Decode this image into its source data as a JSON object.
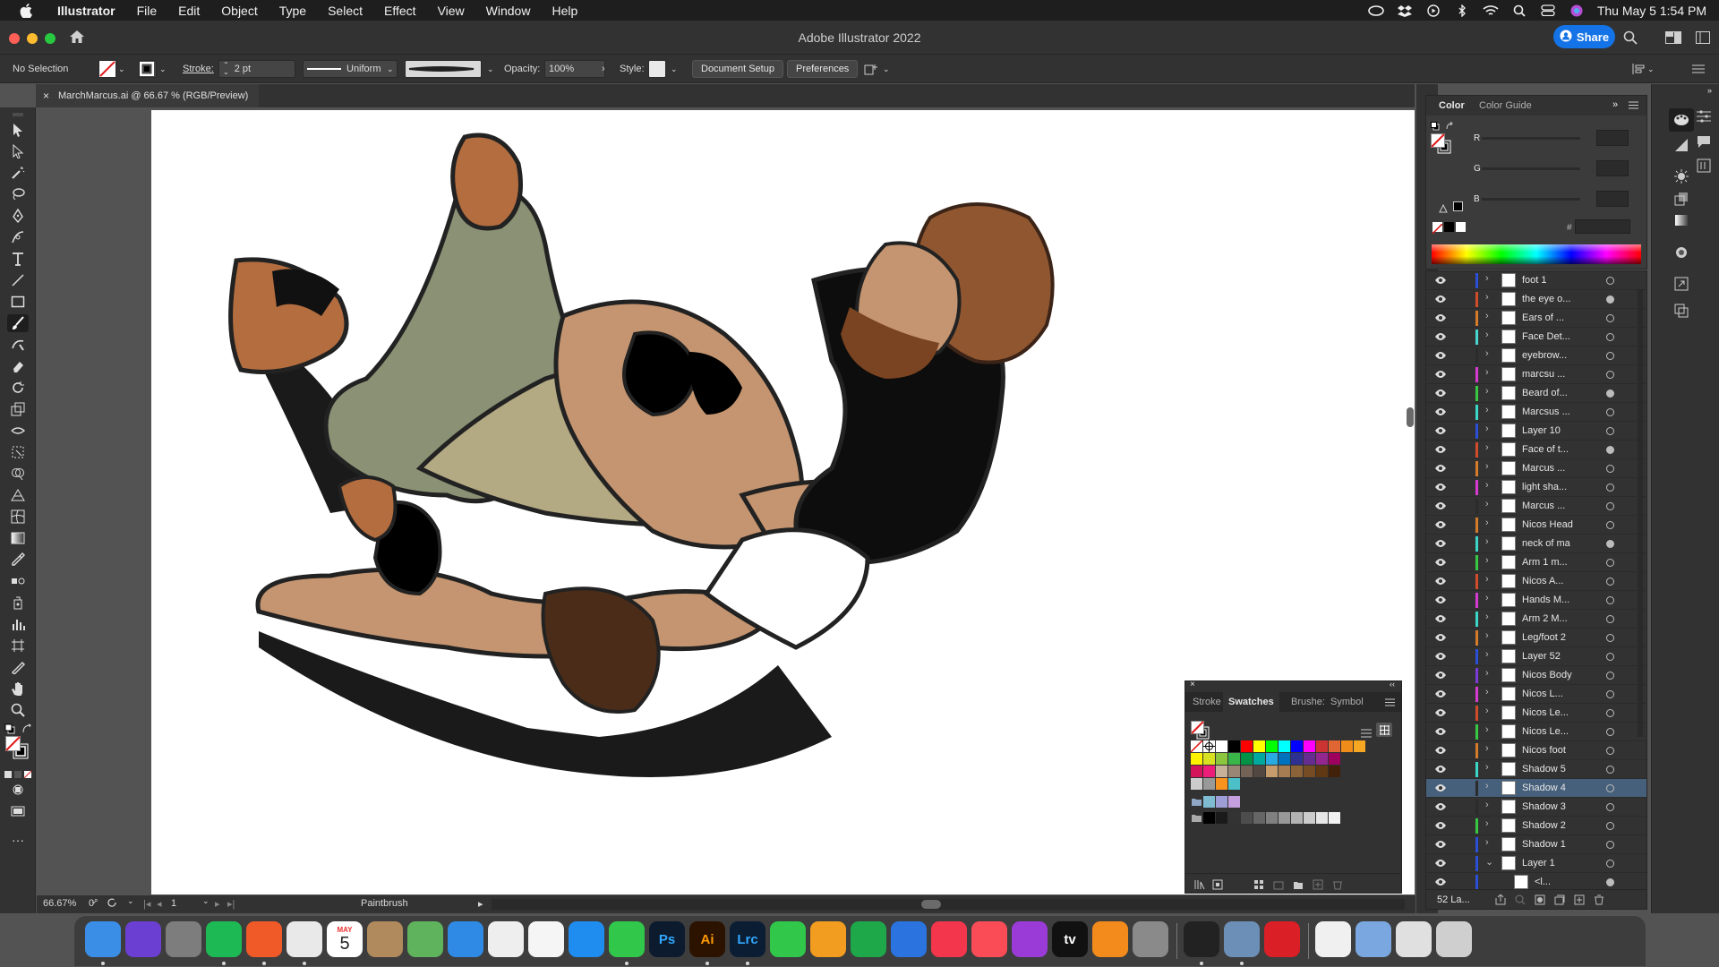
{
  "menubar": {
    "items": [
      "Illustrator",
      "File",
      "Edit",
      "Object",
      "Type",
      "Select",
      "Effect",
      "View",
      "Window",
      "Help"
    ],
    "datetime": "Thu May 5  1:54 PM"
  },
  "window": {
    "title": "Adobe Illustrator 2022",
    "share_label": "Share"
  },
  "controlbar": {
    "selection": "No Selection",
    "stroke_label": "Stroke:",
    "stroke_value": "2 pt",
    "profile": "Uniform",
    "opacity_label": "Opacity:",
    "opacity_value": "100%",
    "style_label": "Style:",
    "document_setup": "Document Setup",
    "preferences": "Preferences"
  },
  "document": {
    "tab_title": "MarchMarcus.ai @ 66.67 % (RGB/Preview)"
  },
  "statusbar": {
    "zoom": "66.67%",
    "rotation": "0°",
    "artboard": "1",
    "tool": "Paintbrush"
  },
  "color_panel": {
    "tabs": [
      "Color",
      "Color Guide"
    ],
    "channels": [
      "R",
      "G",
      "B"
    ],
    "hex_label": "#"
  },
  "layers_panel": {
    "layers": [
      {
        "name": "foot 1",
        "color": "#2b4fd6",
        "fill": false
      },
      {
        "name": "the eye o...",
        "color": "#d14c2a",
        "fill": true
      },
      {
        "name": "Ears of ...",
        "color": "#d67b2a",
        "fill": false
      },
      {
        "name": "Face Det...",
        "color": "#4ad6d0",
        "fill": false
      },
      {
        "name": "eyebrow...",
        "color": "#2b2b2b",
        "fill": false
      },
      {
        "name": "marcsu ...",
        "color": "#d63bd1",
        "fill": false
      },
      {
        "name": "Beard of...",
        "color": "#37c944",
        "fill": true
      },
      {
        "name": "Marcsus ...",
        "color": "#3bd6c6",
        "fill": false
      },
      {
        "name": "Layer 10",
        "color": "#2b4fd6",
        "fill": false
      },
      {
        "name": "Face of t...",
        "color": "#d14c2a",
        "fill": true
      },
      {
        "name": "Marcus ...",
        "color": "#d67b2a",
        "fill": false
      },
      {
        "name": "light sha...",
        "color": "#d63bd1",
        "fill": false
      },
      {
        "name": "Marcus ...",
        "color": "#2b2b2b",
        "fill": false
      },
      {
        "name": "Nicos Head",
        "color": "#d67b2a",
        "fill": false
      },
      {
        "name": "neck of ma",
        "color": "#3bd6c6",
        "fill": true
      },
      {
        "name": "Arm 1 m...",
        "color": "#37c944",
        "fill": false
      },
      {
        "name": "Nicos A...",
        "color": "#d14c2a",
        "fill": false
      },
      {
        "name": "Hands M...",
        "color": "#d63bd1",
        "fill": false
      },
      {
        "name": "Arm 2 M...",
        "color": "#3bd6c6",
        "fill": false
      },
      {
        "name": "Leg/foot 2",
        "color": "#d67b2a",
        "fill": false
      },
      {
        "name": "Layer 52",
        "color": "#2b4fd6",
        "fill": false
      },
      {
        "name": "Nicos Body",
        "color": "#7a3bd6",
        "fill": false
      },
      {
        "name": "Nicos L...",
        "color": "#d63bd1",
        "fill": false
      },
      {
        "name": "Nicos Le...",
        "color": "#d14c2a",
        "fill": false
      },
      {
        "name": "Nicos Le...",
        "color": "#37c944",
        "fill": false
      },
      {
        "name": "Nicos foot",
        "color": "#d67b2a",
        "fill": false
      },
      {
        "name": "Shadow 5",
        "color": "#3bd6c6",
        "fill": false
      },
      {
        "name": "Shadow 4",
        "color": "#2b2b2b",
        "fill": false,
        "selected": true
      },
      {
        "name": "Shadow 3",
        "color": "#2b2b2b",
        "fill": false
      },
      {
        "name": "Shadow 2",
        "color": "#37c944",
        "fill": false
      },
      {
        "name": "Shadow 1",
        "color": "#2b4fd6",
        "fill": false
      },
      {
        "name": "Layer 1",
        "color": "#2b4fd6",
        "fill": false
      },
      {
        "name": "<l...",
        "color": "#2b4fd6",
        "fill": true
      }
    ],
    "footer_count": "52 La..."
  },
  "swatches_panel": {
    "tabs": [
      "Stroke",
      "Swatches",
      "Brushe:",
      "Symbol"
    ],
    "rows": [
      [
        "#ffffff",
        "#000000",
        "#ff0000",
        "#ffff00",
        "#00ff00",
        "#00ffff",
        "#0000ff",
        "#ff00ff",
        "#cc3333",
        "#e06633",
        "#f08c1a",
        "#f7a823"
      ],
      [
        "#fff200",
        "#d7e021",
        "#8cc63f",
        "#39b54a",
        "#009245",
        "#00a99d",
        "#29abe2",
        "#0071bc",
        "#2e3192",
        "#662d91",
        "#93278f",
        "#9e005d"
      ],
      [
        "#d4145a",
        "#ed1e79",
        "#c7b299",
        "#998675",
        "#736357",
        "#534741",
        "#c69c6d",
        "#a67c52",
        "#8c6239",
        "#754c24",
        "#603813",
        "#42210b"
      ],
      [
        "#cccccc",
        "#999999",
        "#f7931e",
        "#4bc0c8"
      ]
    ],
    "gray_row": [
      "#000000",
      "#1a1a1a",
      "#333333",
      "#4d4d4d",
      "#666666",
      "#808080",
      "#999999",
      "#b3b3b3",
      "#cccccc",
      "#e6e6e6",
      "#f2f2f2"
    ],
    "extra": [
      "#7fbcd2",
      "#9e9ed6",
      "#c3a0dd"
    ]
  },
  "dock": {
    "calendar_month": "MAY",
    "calendar_day": "5",
    "apps": [
      {
        "name": "finder-icon",
        "label": "",
        "color": "#3a8ee6"
      },
      {
        "name": "siri-icon",
        "label": "",
        "color": "#6b3fd1"
      },
      {
        "name": "launchpad-icon",
        "label": "",
        "color": "#7d7d7d"
      },
      {
        "name": "spotify-icon",
        "label": "",
        "color": "#1db954"
      },
      {
        "name": "brave-icon",
        "label": "",
        "color": "#f05a28"
      },
      {
        "name": "chrome-icon",
        "label": "",
        "color": "#e9e9e9"
      },
      {
        "name": "calendar-icon",
        "label": "",
        "color": "#ffffff"
      },
      {
        "name": "contacts-icon",
        "label": "",
        "color": "#b08a5c"
      },
      {
        "name": "maps-icon",
        "label": "",
        "color": "#5fb35c"
      },
      {
        "name": "safari-icon",
        "label": "",
        "color": "#2f8ae6"
      },
      {
        "name": "photos-icon",
        "label": "",
        "color": "#eeeeee"
      },
      {
        "name": "reminders-icon",
        "label": "",
        "color": "#f5f5f5"
      },
      {
        "name": "app-store-icon",
        "label": "",
        "color": "#1f8cf0"
      },
      {
        "name": "messages-icon",
        "label": "",
        "color": "#30c74b"
      },
      {
        "name": "photoshop-icon",
        "label": "Ps",
        "color": "#0d1b2f"
      },
      {
        "name": "illustrator-icon",
        "label": "Ai",
        "color": "#2b1300"
      },
      {
        "name": "lightroom-icon",
        "label": "Lrc",
        "color": "#0b1d33"
      },
      {
        "name": "facetime-icon",
        "label": "",
        "color": "#30c74b"
      },
      {
        "name": "pages-icon",
        "label": "",
        "color": "#f29d1f"
      },
      {
        "name": "numbers-icon",
        "label": "",
        "color": "#1ea84a"
      },
      {
        "name": "keynote-icon",
        "label": "",
        "color": "#2b74e0"
      },
      {
        "name": "news-icon",
        "label": "",
        "color": "#f4364c"
      },
      {
        "name": "music-icon",
        "label": "",
        "color": "#f94c57"
      },
      {
        "name": "podcasts-icon",
        "label": "",
        "color": "#9a3bd8"
      },
      {
        "name": "tv-icon",
        "label": "tv",
        "color": "#111111"
      },
      {
        "name": "books-icon",
        "label": "",
        "color": "#f28b1c"
      },
      {
        "name": "system-preferences-icon",
        "label": "",
        "color": "#8a8a8a"
      },
      {
        "name": "activity-monitor-icon",
        "label": "",
        "color": "#222222"
      },
      {
        "name": "preview-icon",
        "label": "",
        "color": "#6c8fb8"
      },
      {
        "name": "creative-cloud-icon",
        "label": "",
        "color": "#da1f26"
      },
      {
        "name": "document-icon",
        "label": "",
        "color": "#f0f0f0"
      },
      {
        "name": "downloads-stack-icon",
        "label": "",
        "color": "#7aa7e0"
      },
      {
        "name": "screenshot-stack-icon",
        "label": "",
        "color": "#e0e0e0"
      },
      {
        "name": "trash-icon",
        "label": "",
        "color": "#cfcfcf"
      }
    ]
  }
}
